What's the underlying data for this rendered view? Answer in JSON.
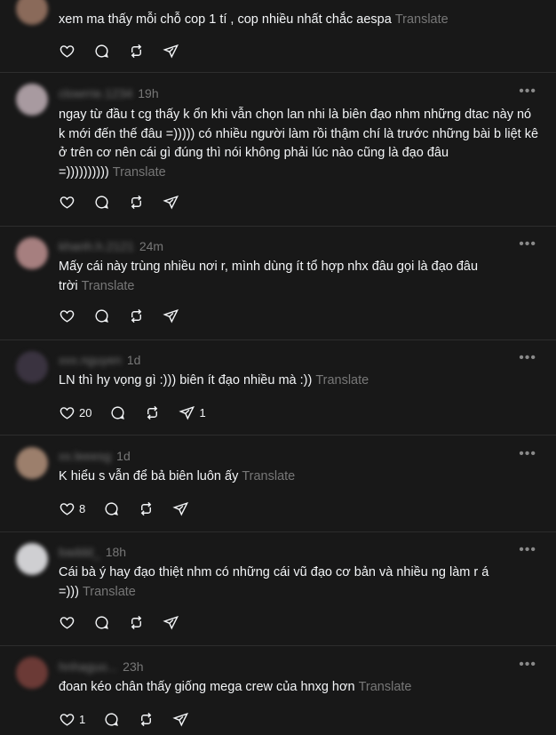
{
  "posts": [
    {
      "user": "",
      "time": "",
      "text": "xem ma thấy mỗi chỗ cop 1 tí , cop nhiều nhất chắc aespa",
      "translate": "Translate",
      "likes": "",
      "shares": "",
      "avatar_color": "#8a6a5a"
    },
    {
      "user": "clowrrie.1234",
      "time": "19h",
      "text": "ngay từ đầu t cg thấy k ổn khi vẫn chọn lan nhi là biên đạo nhm những dtac này nó k mới đến thế đâu =))))) có nhiều người làm rồi thậm chí là trước những bài b liệt kê ở trên cơ nên cái gì đúng thì nói không phải lúc nào cũng là đạo đâu =))))))))))",
      "translate": "Translate",
      "likes": "",
      "shares": "",
      "avatar_color": "#a89aa0"
    },
    {
      "user": "khanh.h.2121",
      "time": "24m",
      "text": "Mấy cái này trùng nhiều nơi r, mình dùng ít tổ hợp nhx đâu gọi là đạo đâu trời",
      "translate": "Translate",
      "likes": "",
      "shares": "",
      "avatar_color": "#a67f7f"
    },
    {
      "user": "xxx.nguyen",
      "time": "1d",
      "text": "LN thì hy vọng gì :))) biên ít đạo nhiều mà :))",
      "translate": "Translate",
      "likes": "20",
      "shares": "1",
      "avatar_color": "#3a3340"
    },
    {
      "user": "xx.leeesg",
      "time": "1d",
      "text": "K hiểu s vẫn để bả biên luôn ấy",
      "translate": "Translate",
      "likes": "8",
      "shares": "",
      "avatar_color": "#9c7f6c"
    },
    {
      "user": "baddd_",
      "time": "18h",
      "text": "Cái bà ý hay đạo thiệt nhm có những cái vũ đạo cơ bản và nhiều ng làm r á =)))",
      "translate": "Translate",
      "likes": "",
      "shares": "",
      "avatar_color": "#cfcfd2"
    },
    {
      "user": "hnhaguo...",
      "time": "23h",
      "text": "đoan kéo chân thấy giống mega crew của hnxg hơn",
      "translate": "Translate",
      "likes": "1",
      "shares": "",
      "avatar_color": "#6b3a36"
    }
  ],
  "more_label": "•••",
  "colors": {
    "background": "#181818",
    "text": "#f3f5f7",
    "muted": "#777777",
    "divider": "#2d2d2d"
  },
  "icons": [
    "heart-icon",
    "comment-icon",
    "repost-icon",
    "share-icon",
    "more-icon"
  ]
}
